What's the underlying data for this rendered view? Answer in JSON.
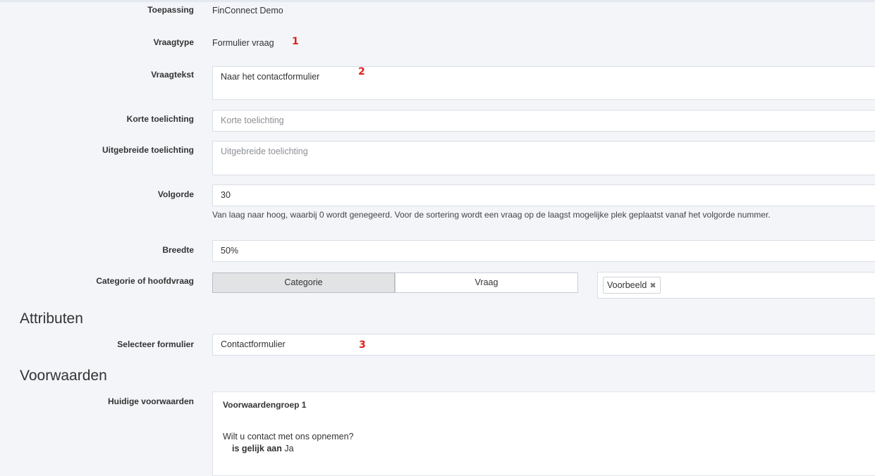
{
  "fields": {
    "toepassing": {
      "label": "Toepassing",
      "value": "FinConnect Demo"
    },
    "vraagtype": {
      "label": "Vraagtype",
      "value": "Formulier vraag"
    },
    "vraagtekst": {
      "label": "Vraagtekst",
      "value": "Naar het contactformulier"
    },
    "korte_toelichting": {
      "label": "Korte toelichting",
      "value": "",
      "placeholder": "Korte toelichting"
    },
    "uitgebreide_toelichting": {
      "label": "Uitgebreide toelichting",
      "value": "",
      "placeholder": "Uitgebreide toelichting"
    },
    "volgorde": {
      "label": "Volgorde",
      "value": "30",
      "help": "Van laag naar hoog, waarbij 0 wordt genegeerd. Voor de sortering wordt een vraag op de laagst mogelijke plek geplaatst vanaf het volgorde nummer."
    },
    "breedte": {
      "label": "Breedte",
      "value": "50%"
    },
    "categorie": {
      "label": "Categorie of hoofdvraag",
      "options": [
        "Categorie",
        "Vraag"
      ],
      "selected": "Categorie",
      "tags": [
        "Voorbeeld"
      ]
    }
  },
  "attributen": {
    "title": "Attributen",
    "selecteer_formulier": {
      "label": "Selecteer formulier",
      "value": "Contactformulier"
    }
  },
  "voorwaarden": {
    "title": "Voorwaarden",
    "huidige": {
      "label": "Huidige voorwaarden",
      "group_title": "Voorwaardengroep 1",
      "question": "Wilt u contact met ons opnemen?",
      "operator": "is gelijk aan",
      "answer": "Ja"
    }
  },
  "annotations": [
    "1",
    "2",
    "3"
  ],
  "colors": {
    "annotation": "#e02020",
    "background": "#f3f5f9",
    "active_segment": "#e2e3e5"
  }
}
